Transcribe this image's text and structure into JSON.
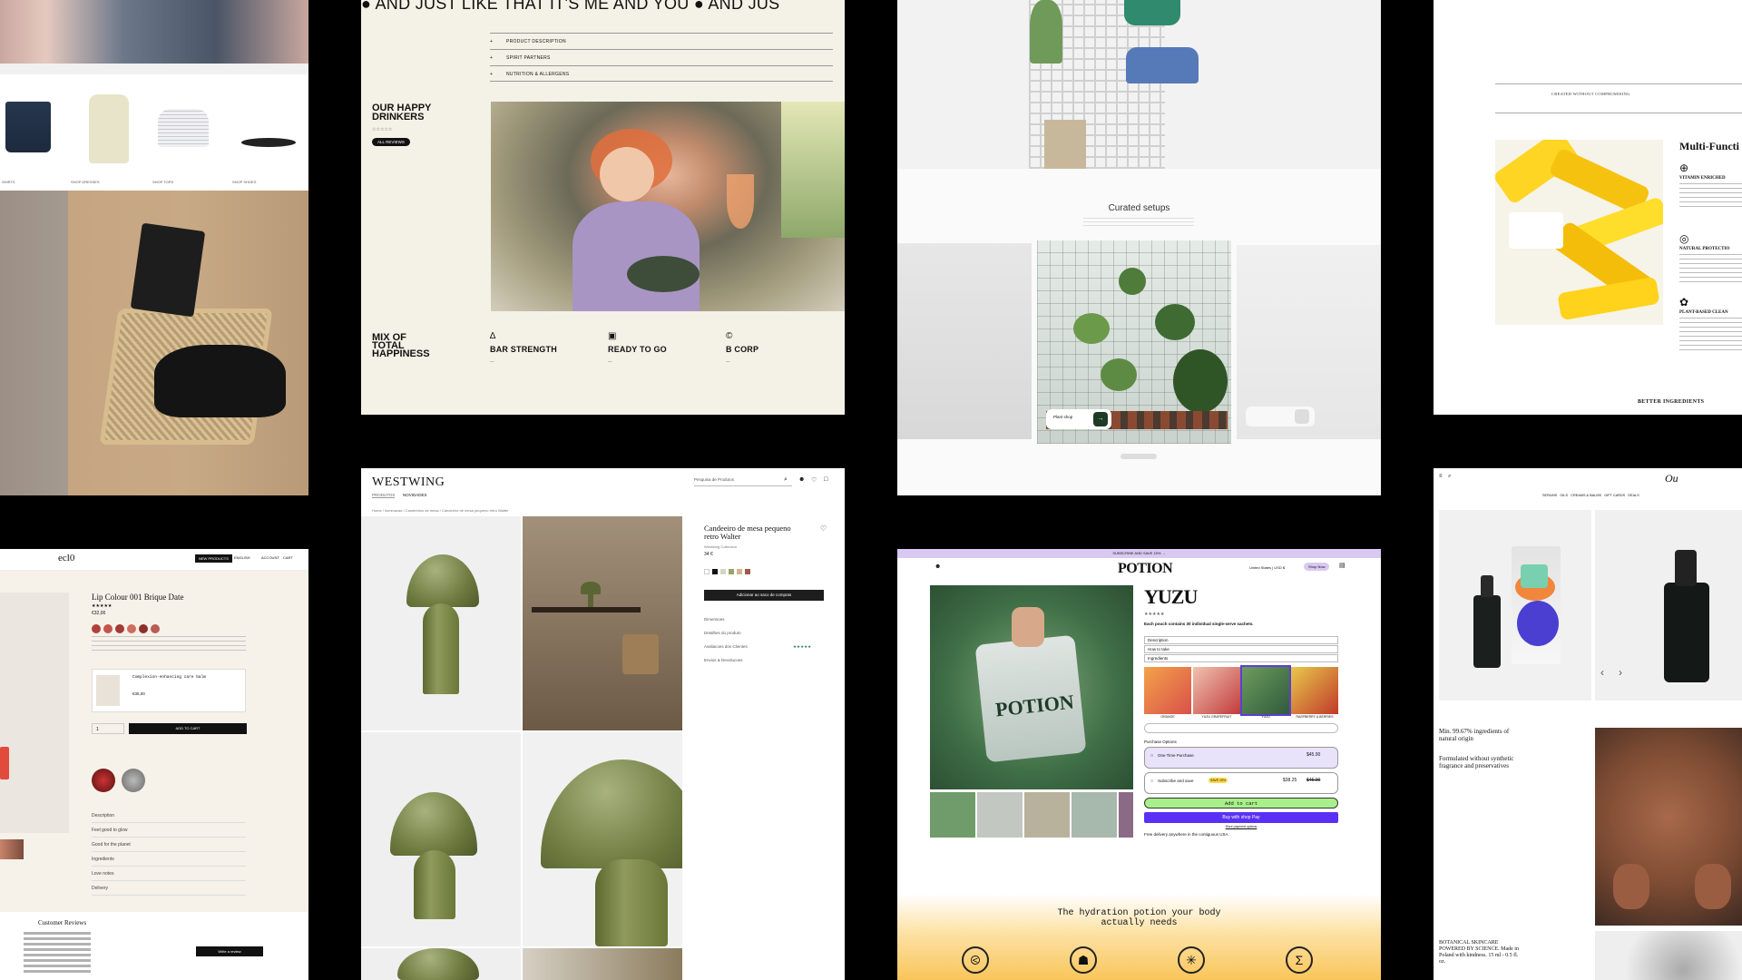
{
  "card_a": {
    "menu": [
      "SHIRTS",
      "SHOP DRESSES",
      "SHOP TOPS",
      "SHOP SHOES"
    ]
  },
  "card_b": {
    "marquee": "AND JUST LIKE THAT IT'S ME AND YOU",
    "marquee2": "AND JUS",
    "accordion": [
      {
        "sign": "+",
        "label": "PRODUCT DESCRIPTION"
      },
      {
        "sign": "+",
        "label": "SPIRIT PARTNERS"
      },
      {
        "sign": "+",
        "label": "NUTRITION & ALLERGENS"
      }
    ],
    "happy_title": "OUR HAPPY DRINKERS",
    "all_reviews": "ALL REVIEWS",
    "mix_title": "MIX OF TOTAL HAPPINESS",
    "features": [
      {
        "icon": "∆",
        "title": "BAR STRENGTH"
      },
      {
        "icon": "▣",
        "title": "READY TO GO"
      },
      {
        "icon": "©",
        "title": "B CORP"
      }
    ]
  },
  "card_c": {
    "heading": "Curated setups",
    "chip_label": "Plant shop",
    "chip_button": "→"
  },
  "card_d": {
    "heading": "Multi-Functi",
    "items": [
      {
        "icon": "⊕",
        "title": "VITAMIN ENRICHED"
      },
      {
        "icon": "◎",
        "title": "NATURAL PROTECTIO"
      },
      {
        "icon": "✿",
        "title": "PLANT-BASED CLEAN"
      }
    ],
    "footer": "BETTER INGREDIENTS",
    "top_note": "CREATED WITHOUT COMPROMISING"
  },
  "card_e": {
    "brand": "ecl0",
    "nav": [
      "NEW PRODUCTS",
      "ENGLISH",
      "ACCOUNT",
      "CART"
    ],
    "product_title": "Lip Colour 001 Brique Date",
    "price": "€32,00",
    "add_to_cart": "ADD TO CART",
    "qty": "1",
    "upsell_name": "Complexion-enhancing care balm",
    "upsell_price": "€35,00",
    "accordion": [
      "Description",
      "Feel good to glow",
      "Good for the planet",
      "Ingredients",
      "Love notes",
      "Delivery"
    ],
    "reviews_title": "Customer Reviews",
    "write_review": "Write a review",
    "swatches": [
      "#b0403a",
      "#c2554a",
      "#a33a35",
      "#cf6d5f",
      "#8d2f2a",
      "#b75d56"
    ]
  },
  "card_f": {
    "brand": "WESTWING",
    "tabs": [
      "PRODUTOS",
      "NOVIDADES"
    ],
    "search_placeholder": "Pesquisa de Produtos",
    "breadcrumb": "Home / Iluminacao / Candeeiros de mesa / Candeeiro de mesa pequeno retro Walter",
    "product_title": "Candeeiro de mesa pequeno retro Walter",
    "brand_line": "Westwing Collection",
    "price": "34 €",
    "cta": "Adicionar ao saco de compras",
    "sections": [
      "Dimensoes",
      "Detalhes do produto",
      "Avaliacoes dos Clientes",
      "Envios & Devolucoes"
    ],
    "swatches": [
      "#ffffff",
      "#111111",
      "#d9d4c4",
      "#9aa36a",
      "#c9b88d",
      "#a05a4a"
    ]
  },
  "card_g": {
    "promo": "SUBSCRIBE AND SAVE 15% →",
    "brand": "POTION",
    "region": "United States | USD $",
    "shop_now": "Shop Now",
    "title": "YUZU",
    "subtitle": "Each pouch contains 30 individual single-serve sachets.",
    "accordion": [
      "Description",
      "How to take",
      "Ingredients"
    ],
    "flavors": [
      "ORANGE",
      "YUZU GRAPEFRUIT",
      "YUZU",
      "RASPBERRY & BERRIES"
    ],
    "purchase_label": "Purchase Options",
    "one_time": "One Time Purchase",
    "one_time_price": "$45.00",
    "subscribe": "Subscribe and save",
    "subscribe_badge": "SAVE 15%",
    "subscribe_price": "$38.25",
    "subscribe_old": "$45.00",
    "add_to_cart": "Add to cart",
    "shop_pay": "Buy with shop Pay",
    "more_options": "More payment options",
    "shipping": "Free delivery anywhere in the contiguous USA",
    "tagline": "The hydration potion your body actually needs",
    "bottom_icons": [
      "⧀",
      "☗",
      "✳",
      "Σ"
    ]
  },
  "card_h": {
    "logo": "Ou",
    "nav": [
      "SERUMS",
      "OILS",
      "CREAMS & BALMS",
      "GIFT CARDS",
      "DEALS"
    ],
    "claim1": "Min. 99.67% ingredients of natural origin",
    "claim2": "Formulated without synthetic fragrance and preservatives",
    "footer": "BOTANICAL SKINCARE POWERED BY SCIENCE. Made in Poland with kindness. 15 ml - 0.5 fl. oz."
  }
}
